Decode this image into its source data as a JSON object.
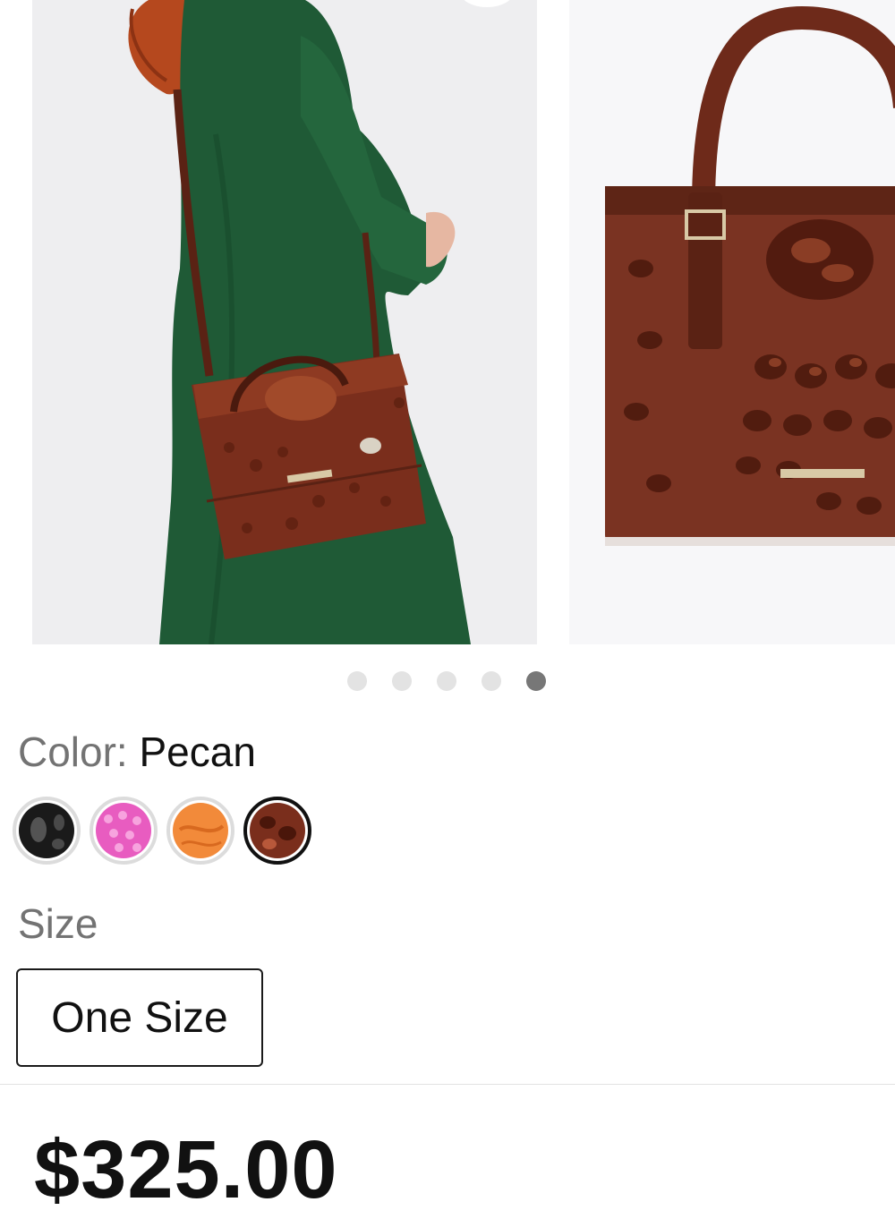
{
  "color": {
    "label": "Color:",
    "value": "Pecan"
  },
  "swatches": [
    {
      "name": "black-croc",
      "color": "#1a1a1a",
      "selected": false
    },
    {
      "name": "pink-croc",
      "color": "#e85cc0",
      "selected": false
    },
    {
      "name": "orange-croc",
      "color": "#f28a3a",
      "selected": false
    },
    {
      "name": "pecan-croc",
      "color": "#7a2e1c",
      "selected": true
    }
  ],
  "carousel": {
    "slide_count": 5,
    "active_index": 4
  },
  "size": {
    "label": "Size",
    "option": "One Size"
  },
  "price": "$325.00",
  "colors": {
    "dress": "#1f5a36",
    "bag": "#7a2e1c",
    "hair": "#b5481e"
  }
}
